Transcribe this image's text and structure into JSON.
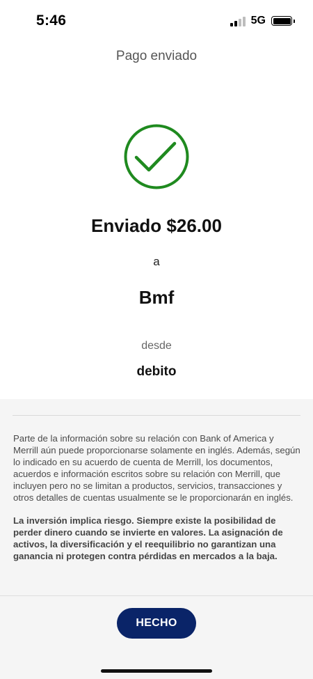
{
  "status_bar": {
    "time": "5:46",
    "network": "5G",
    "signal_icon": "signal-bars-icon",
    "battery_icon": "battery-icon"
  },
  "header": {
    "title": "Pago enviado"
  },
  "confirmation": {
    "icon": "check-circle-icon",
    "icon_color": "#1f8a1f",
    "amount_text": "Enviado $26.00",
    "to_label": "a",
    "recipient": "Bmf",
    "from_label": "desde",
    "account": "debito"
  },
  "disclosures": {
    "paragraph_1": "Parte de la información sobre su relación con Bank of America y Merrill aún puede proporcionarse solamente en inglés. Además, según lo indicado en su acuerdo de cuenta de Merrill, los documentos, acuerdos e información escritos sobre su relación con Merrill, que incluyen pero no se limitan a productos, servicios, transacciones y otros detalles de cuentas usualmente se le proporcionarán en inglés.",
    "paragraph_2": "La inversión implica riesgo. Siempre existe la posibilidad de perder dinero cuando se invierte en valores. La asignación de activos, la diversificación y el reequilibrio no garantizan una ganancia ni protegen contra pérdidas en mercados a la baja."
  },
  "footer": {
    "done_label": "HECHO",
    "button_color": "#0a2468"
  }
}
